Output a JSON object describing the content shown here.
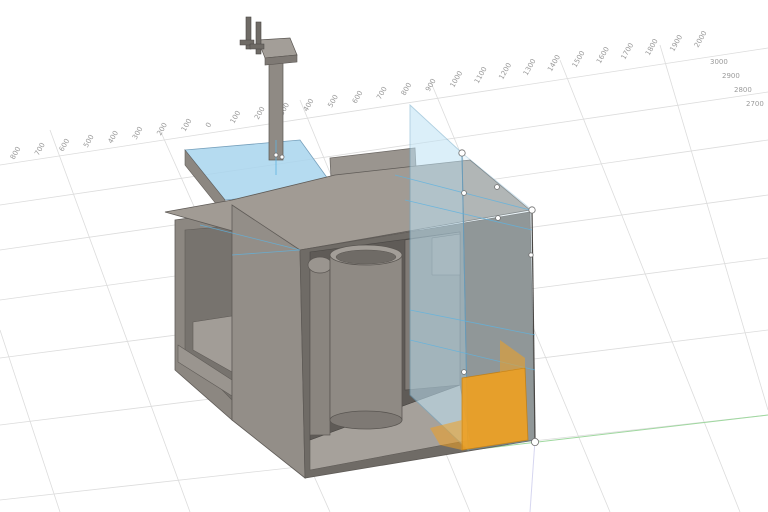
{
  "viewport": {
    "background": "#ffffff",
    "grid_color": "#d9d9d9",
    "x_axis_color": "#e8a0a0",
    "y_axis_color": "#9fd89f",
    "body_color": "#8f8a84",
    "glass_color": "#9fd3f0",
    "highlight_color": "#f0a020"
  },
  "ruler_top": {
    "ticks": [
      "800",
      "700",
      "600",
      "500",
      "400",
      "300",
      "200",
      "100",
      "0",
      "100",
      "200",
      "300",
      "400",
      "500",
      "600",
      "700",
      "800",
      "900",
      "1000",
      "1100",
      "1200",
      "1300",
      "1400",
      "1500",
      "1600",
      "1700",
      "1800",
      "1900",
      "2000"
    ]
  },
  "ruler_right": {
    "ticks": [
      "3000",
      "2900",
      "2800",
      "2700"
    ]
  }
}
